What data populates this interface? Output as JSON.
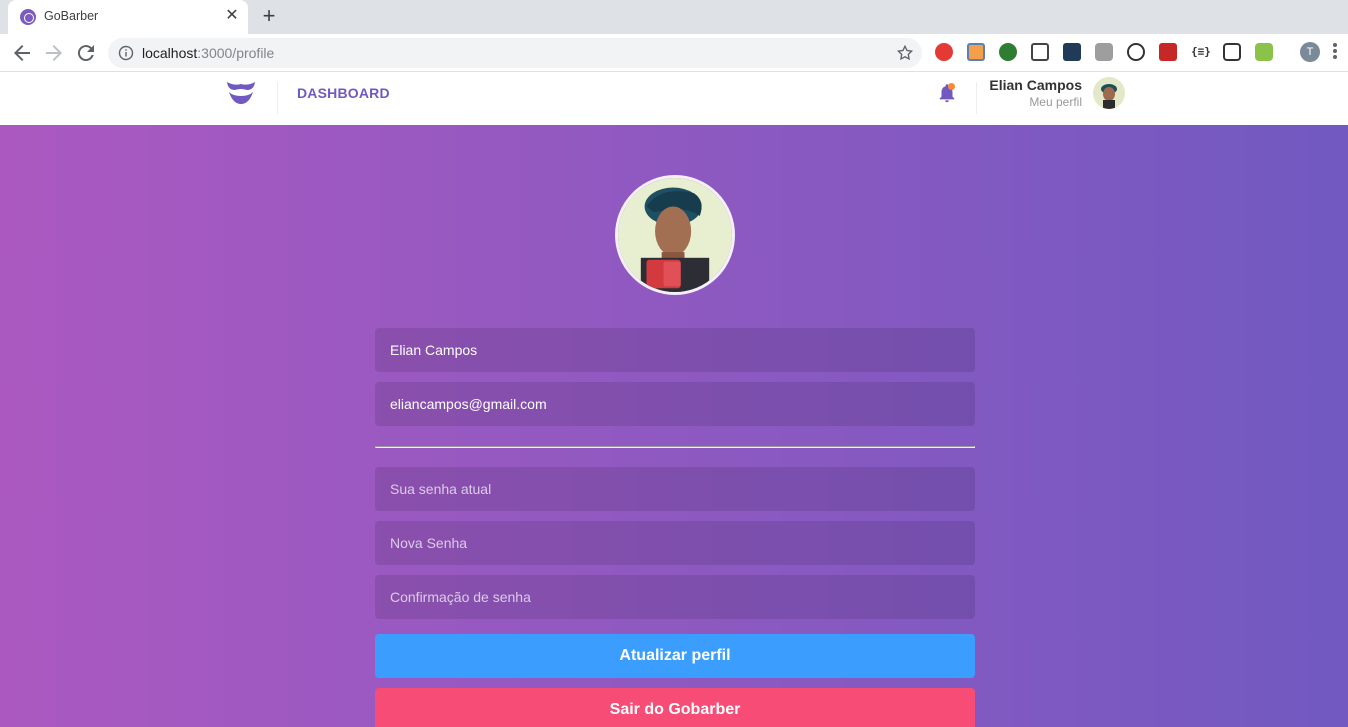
{
  "browser": {
    "tab_title": "GoBarber",
    "url_host": "localhost",
    "url_path": ":3000/profile",
    "profile_initial": "T"
  },
  "header": {
    "nav_link": "DASHBOARD",
    "user_name": "Elian Campos",
    "user_link": "Meu perfil"
  },
  "form": {
    "name_value": "Elian Campos",
    "email_value": "eliancampos@gmail.com",
    "old_password_placeholder": "Sua senha atual",
    "new_password_placeholder": "Nova Senha",
    "confirm_password_placeholder": "Confirmação de senha",
    "update_button": "Atualizar perfil",
    "logout_button": "Sair do Gobarber"
  },
  "colors": {
    "brand": "#7159c1",
    "gradient_start": "#ab59c1",
    "gradient_end": "#7159c1",
    "update_button": "#3b9eff",
    "logout_button": "#f64c75",
    "notification_dot": "#ff892e"
  }
}
